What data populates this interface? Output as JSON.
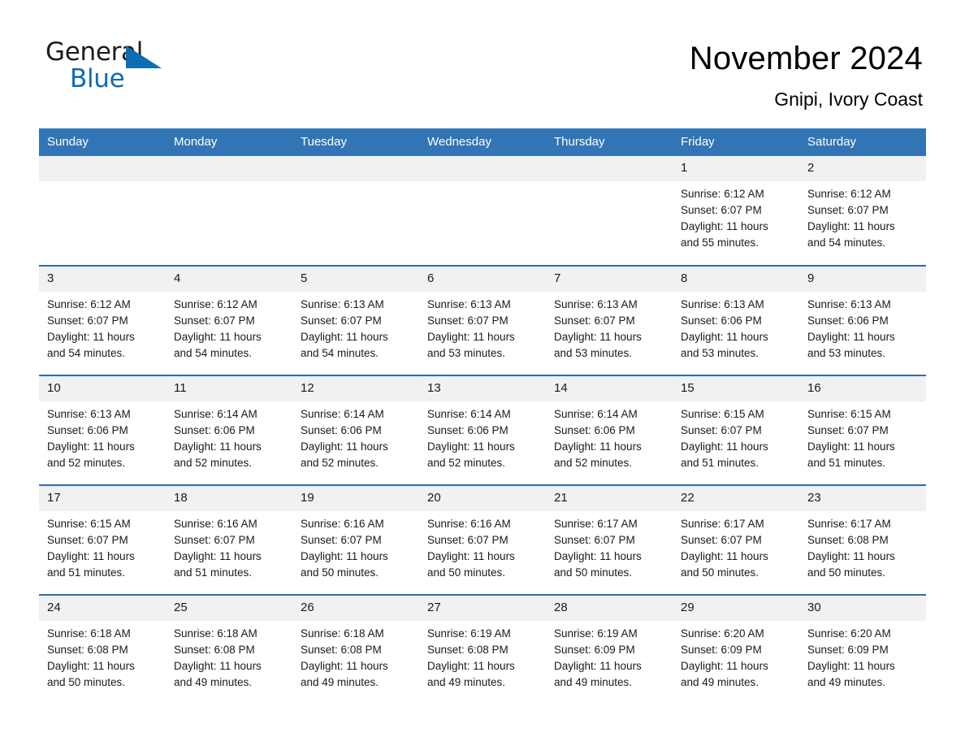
{
  "brand": {
    "word_one": "General",
    "word_two": "Blue",
    "triangle_icon": "triangle-icon",
    "accent_color": "#0d6cb4"
  },
  "header": {
    "title": "November 2024",
    "subtitle": "Gnipi, Ivory Coast"
  },
  "theme": {
    "header_blue": "#3275b5",
    "row_rule_blue": "#2f6ea8",
    "daynum_bg": "#f1f1f1"
  },
  "calendar": {
    "weekday_headers": [
      "Sunday",
      "Monday",
      "Tuesday",
      "Wednesday",
      "Thursday",
      "Friday",
      "Saturday"
    ],
    "weeks": [
      [
        {
          "day": "",
          "empty": true,
          "sunrise": "",
          "sunset": "",
          "daylight_line1": "",
          "daylight_line2": ""
        },
        {
          "day": "",
          "empty": true,
          "sunrise": "",
          "sunset": "",
          "daylight_line1": "",
          "daylight_line2": ""
        },
        {
          "day": "",
          "empty": true,
          "sunrise": "",
          "sunset": "",
          "daylight_line1": "",
          "daylight_line2": ""
        },
        {
          "day": "",
          "empty": true,
          "sunrise": "",
          "sunset": "",
          "daylight_line1": "",
          "daylight_line2": ""
        },
        {
          "day": "",
          "empty": true,
          "sunrise": "",
          "sunset": "",
          "daylight_line1": "",
          "daylight_line2": ""
        },
        {
          "day": "1",
          "empty": false,
          "sunrise": "Sunrise: 6:12 AM",
          "sunset": "Sunset: 6:07 PM",
          "daylight_line1": "Daylight: 11 hours",
          "daylight_line2": "and 55 minutes."
        },
        {
          "day": "2",
          "empty": false,
          "sunrise": "Sunrise: 6:12 AM",
          "sunset": "Sunset: 6:07 PM",
          "daylight_line1": "Daylight: 11 hours",
          "daylight_line2": "and 54 minutes."
        }
      ],
      [
        {
          "day": "3",
          "empty": false,
          "sunrise": "Sunrise: 6:12 AM",
          "sunset": "Sunset: 6:07 PM",
          "daylight_line1": "Daylight: 11 hours",
          "daylight_line2": "and 54 minutes."
        },
        {
          "day": "4",
          "empty": false,
          "sunrise": "Sunrise: 6:12 AM",
          "sunset": "Sunset: 6:07 PM",
          "daylight_line1": "Daylight: 11 hours",
          "daylight_line2": "and 54 minutes."
        },
        {
          "day": "5",
          "empty": false,
          "sunrise": "Sunrise: 6:13 AM",
          "sunset": "Sunset: 6:07 PM",
          "daylight_line1": "Daylight: 11 hours",
          "daylight_line2": "and 54 minutes."
        },
        {
          "day": "6",
          "empty": false,
          "sunrise": "Sunrise: 6:13 AM",
          "sunset": "Sunset: 6:07 PM",
          "daylight_line1": "Daylight: 11 hours",
          "daylight_line2": "and 53 minutes."
        },
        {
          "day": "7",
          "empty": false,
          "sunrise": "Sunrise: 6:13 AM",
          "sunset": "Sunset: 6:07 PM",
          "daylight_line1": "Daylight: 11 hours",
          "daylight_line2": "and 53 minutes."
        },
        {
          "day": "8",
          "empty": false,
          "sunrise": "Sunrise: 6:13 AM",
          "sunset": "Sunset: 6:06 PM",
          "daylight_line1": "Daylight: 11 hours",
          "daylight_line2": "and 53 minutes."
        },
        {
          "day": "9",
          "empty": false,
          "sunrise": "Sunrise: 6:13 AM",
          "sunset": "Sunset: 6:06 PM",
          "daylight_line1": "Daylight: 11 hours",
          "daylight_line2": "and 53 minutes."
        }
      ],
      [
        {
          "day": "10",
          "empty": false,
          "sunrise": "Sunrise: 6:13 AM",
          "sunset": "Sunset: 6:06 PM",
          "daylight_line1": "Daylight: 11 hours",
          "daylight_line2": "and 52 minutes."
        },
        {
          "day": "11",
          "empty": false,
          "sunrise": "Sunrise: 6:14 AM",
          "sunset": "Sunset: 6:06 PM",
          "daylight_line1": "Daylight: 11 hours",
          "daylight_line2": "and 52 minutes."
        },
        {
          "day": "12",
          "empty": false,
          "sunrise": "Sunrise: 6:14 AM",
          "sunset": "Sunset: 6:06 PM",
          "daylight_line1": "Daylight: 11 hours",
          "daylight_line2": "and 52 minutes."
        },
        {
          "day": "13",
          "empty": false,
          "sunrise": "Sunrise: 6:14 AM",
          "sunset": "Sunset: 6:06 PM",
          "daylight_line1": "Daylight: 11 hours",
          "daylight_line2": "and 52 minutes."
        },
        {
          "day": "14",
          "empty": false,
          "sunrise": "Sunrise: 6:14 AM",
          "sunset": "Sunset: 6:06 PM",
          "daylight_line1": "Daylight: 11 hours",
          "daylight_line2": "and 52 minutes."
        },
        {
          "day": "15",
          "empty": false,
          "sunrise": "Sunrise: 6:15 AM",
          "sunset": "Sunset: 6:07 PM",
          "daylight_line1": "Daylight: 11 hours",
          "daylight_line2": "and 51 minutes."
        },
        {
          "day": "16",
          "empty": false,
          "sunrise": "Sunrise: 6:15 AM",
          "sunset": "Sunset: 6:07 PM",
          "daylight_line1": "Daylight: 11 hours",
          "daylight_line2": "and 51 minutes."
        }
      ],
      [
        {
          "day": "17",
          "empty": false,
          "sunrise": "Sunrise: 6:15 AM",
          "sunset": "Sunset: 6:07 PM",
          "daylight_line1": "Daylight: 11 hours",
          "daylight_line2": "and 51 minutes."
        },
        {
          "day": "18",
          "empty": false,
          "sunrise": "Sunrise: 6:16 AM",
          "sunset": "Sunset: 6:07 PM",
          "daylight_line1": "Daylight: 11 hours",
          "daylight_line2": "and 51 minutes."
        },
        {
          "day": "19",
          "empty": false,
          "sunrise": "Sunrise: 6:16 AM",
          "sunset": "Sunset: 6:07 PM",
          "daylight_line1": "Daylight: 11 hours",
          "daylight_line2": "and 50 minutes."
        },
        {
          "day": "20",
          "empty": false,
          "sunrise": "Sunrise: 6:16 AM",
          "sunset": "Sunset: 6:07 PM",
          "daylight_line1": "Daylight: 11 hours",
          "daylight_line2": "and 50 minutes."
        },
        {
          "day": "21",
          "empty": false,
          "sunrise": "Sunrise: 6:17 AM",
          "sunset": "Sunset: 6:07 PM",
          "daylight_line1": "Daylight: 11 hours",
          "daylight_line2": "and 50 minutes."
        },
        {
          "day": "22",
          "empty": false,
          "sunrise": "Sunrise: 6:17 AM",
          "sunset": "Sunset: 6:07 PM",
          "daylight_line1": "Daylight: 11 hours",
          "daylight_line2": "and 50 minutes."
        },
        {
          "day": "23",
          "empty": false,
          "sunrise": "Sunrise: 6:17 AM",
          "sunset": "Sunset: 6:08 PM",
          "daylight_line1": "Daylight: 11 hours",
          "daylight_line2": "and 50 minutes."
        }
      ],
      [
        {
          "day": "24",
          "empty": false,
          "sunrise": "Sunrise: 6:18 AM",
          "sunset": "Sunset: 6:08 PM",
          "daylight_line1": "Daylight: 11 hours",
          "daylight_line2": "and 50 minutes."
        },
        {
          "day": "25",
          "empty": false,
          "sunrise": "Sunrise: 6:18 AM",
          "sunset": "Sunset: 6:08 PM",
          "daylight_line1": "Daylight: 11 hours",
          "daylight_line2": "and 49 minutes."
        },
        {
          "day": "26",
          "empty": false,
          "sunrise": "Sunrise: 6:18 AM",
          "sunset": "Sunset: 6:08 PM",
          "daylight_line1": "Daylight: 11 hours",
          "daylight_line2": "and 49 minutes."
        },
        {
          "day": "27",
          "empty": false,
          "sunrise": "Sunrise: 6:19 AM",
          "sunset": "Sunset: 6:08 PM",
          "daylight_line1": "Daylight: 11 hours",
          "daylight_line2": "and 49 minutes."
        },
        {
          "day": "28",
          "empty": false,
          "sunrise": "Sunrise: 6:19 AM",
          "sunset": "Sunset: 6:09 PM",
          "daylight_line1": "Daylight: 11 hours",
          "daylight_line2": "and 49 minutes."
        },
        {
          "day": "29",
          "empty": false,
          "sunrise": "Sunrise: 6:20 AM",
          "sunset": "Sunset: 6:09 PM",
          "daylight_line1": "Daylight: 11 hours",
          "daylight_line2": "and 49 minutes."
        },
        {
          "day": "30",
          "empty": false,
          "sunrise": "Sunrise: 6:20 AM",
          "sunset": "Sunset: 6:09 PM",
          "daylight_line1": "Daylight: 11 hours",
          "daylight_line2": "and 49 minutes."
        }
      ]
    ]
  }
}
